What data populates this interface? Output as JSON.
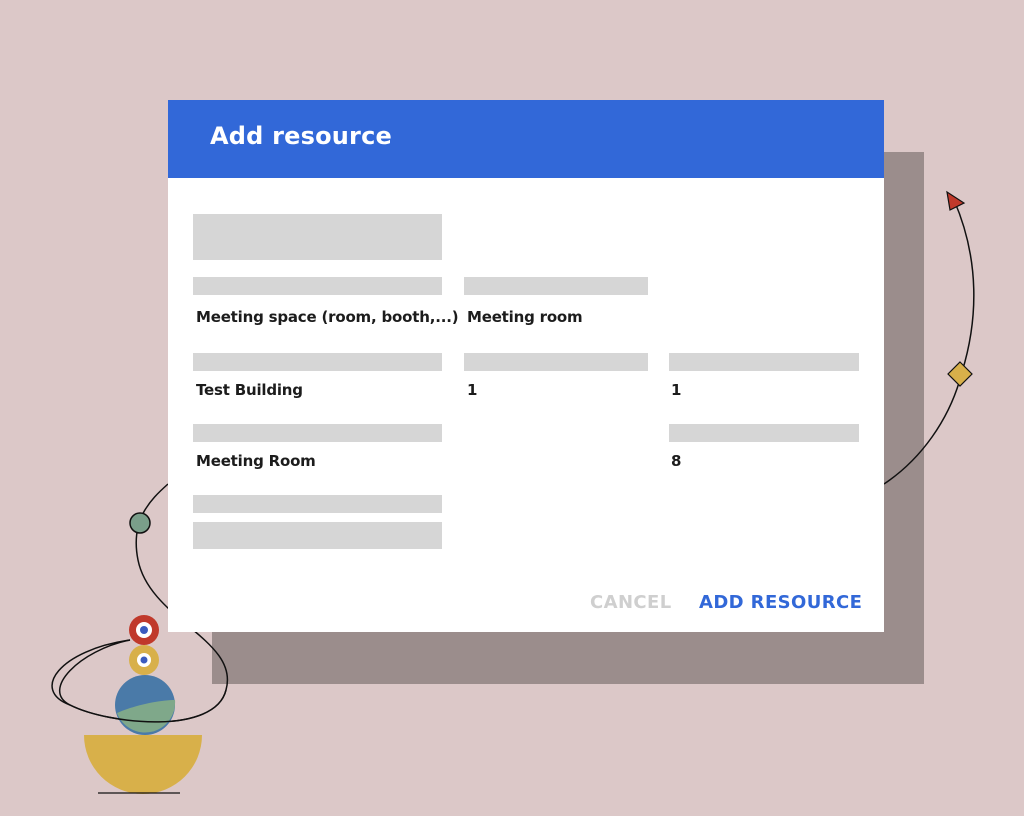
{
  "dialog": {
    "title": "Add resource",
    "fields": {
      "resource_type": "Meeting space (room, booth,...)",
      "category": "Meeting room",
      "building": "Test Building",
      "floor": "1",
      "floor_section": "1",
      "name": "Meeting Room",
      "capacity": "8"
    },
    "buttons": {
      "cancel": "CANCEL",
      "add": "ADD RESOURCE"
    }
  },
  "colors": {
    "background": "#dcc8c8",
    "header": "#3268d8",
    "accent": "#3268d8",
    "placeholder": "#d6d6d6",
    "shadow": "#9b8d8c"
  }
}
